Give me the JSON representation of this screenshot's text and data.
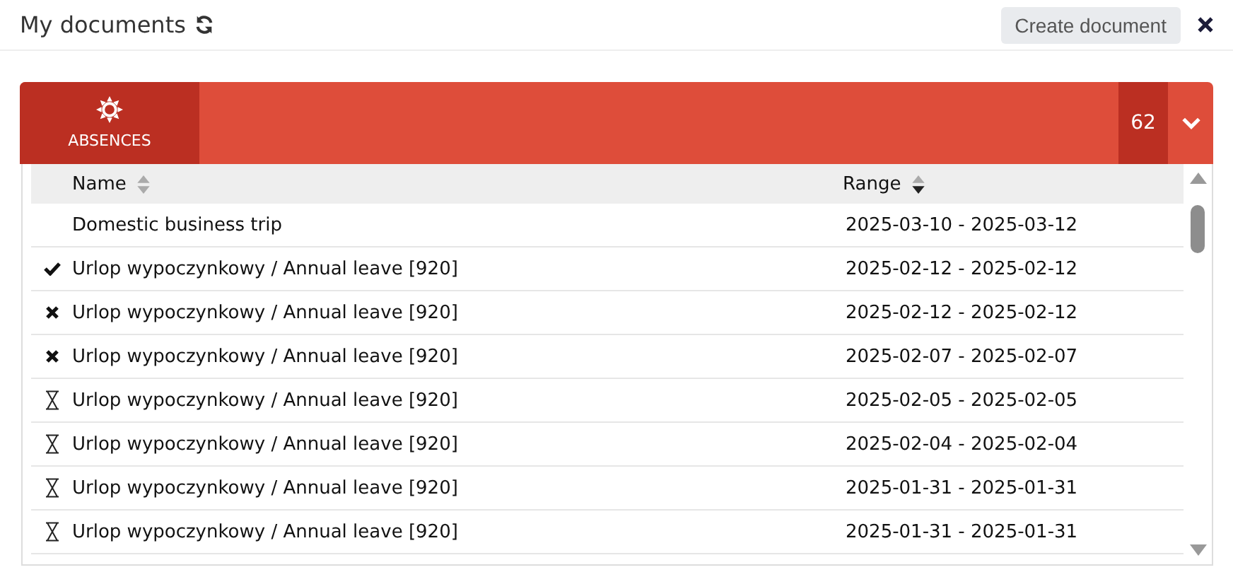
{
  "header": {
    "title": "My documents",
    "create_button": "Create document"
  },
  "category": {
    "label": "ABSENCES",
    "count": "62",
    "expanded": true
  },
  "table": {
    "columns": [
      {
        "label": "Name",
        "sorted": false
      },
      {
        "label": "Range",
        "sorted": true
      }
    ],
    "rows": [
      {
        "kind": "plain",
        "name": "Domestic business trip",
        "range": "2025-03-10 - 2025-03-12"
      },
      {
        "kind": "approved",
        "name": "Urlop wypoczynkowy / Annual leave [920]",
        "range": "2025-02-12 - 2025-02-12"
      },
      {
        "kind": "rejected",
        "name": "Urlop wypoczynkowy / Annual leave [920]",
        "range": "2025-02-12 - 2025-02-12"
      },
      {
        "kind": "rejected",
        "name": "Urlop wypoczynkowy / Annual leave [920]",
        "range": "2025-02-07 - 2025-02-07"
      },
      {
        "kind": "pending",
        "name": "Urlop wypoczynkowy / Annual leave [920]",
        "range": "2025-02-05 - 2025-02-05"
      },
      {
        "kind": "pending",
        "name": "Urlop wypoczynkowy / Annual leave [920]",
        "range": "2025-02-04 - 2025-02-04"
      },
      {
        "kind": "pending",
        "name": "Urlop wypoczynkowy / Annual leave [920]",
        "range": "2025-01-31 - 2025-01-31"
      },
      {
        "kind": "pending",
        "name": "Urlop wypoczynkowy / Annual leave [920]",
        "range": "2025-01-31 - 2025-01-31"
      }
    ]
  }
}
